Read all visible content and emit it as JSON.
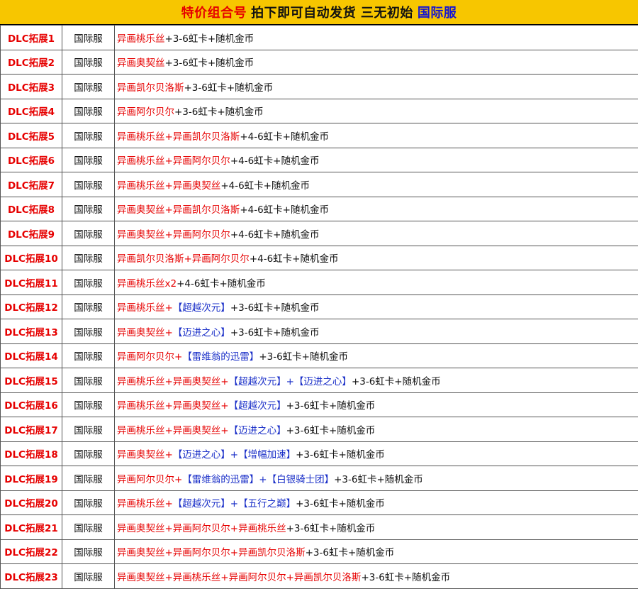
{
  "header": {
    "red": "特价组合号",
    "black": "拍下即可自动发货 三无初始",
    "blue": "国际服"
  },
  "colors": {
    "red": "#e60000",
    "blue": "#1a2fc8",
    "black": "#111111",
    "header_bg": "#f7c600"
  },
  "rows": [
    {
      "dlc": "DLC拓展1",
      "server": "国际服",
      "segs": [
        [
          "r",
          "异画桃乐丝"
        ],
        [
          "k",
          "+3-6虹卡+随机金币"
        ]
      ]
    },
    {
      "dlc": "DLC拓展2",
      "server": "国际服",
      "segs": [
        [
          "r",
          "异画奥契丝"
        ],
        [
          "k",
          "+3-6虹卡+随机金币"
        ]
      ]
    },
    {
      "dlc": "DLC拓展3",
      "server": "国际服",
      "segs": [
        [
          "r",
          "异画凯尔贝洛斯"
        ],
        [
          "k",
          "+3-6虹卡+随机金币"
        ]
      ]
    },
    {
      "dlc": "DLC拓展4",
      "server": "国际服",
      "segs": [
        [
          "r",
          "异画阿尔贝尔"
        ],
        [
          "k",
          "+3-6虹卡+随机金币"
        ]
      ]
    },
    {
      "dlc": "DLC拓展5",
      "server": "国际服",
      "segs": [
        [
          "r",
          "异画桃乐丝+异画凯尔贝洛斯"
        ],
        [
          "k",
          "+4-6虹卡+随机金币"
        ]
      ]
    },
    {
      "dlc": "DLC拓展6",
      "server": "国际服",
      "segs": [
        [
          "r",
          "异画桃乐丝+异画阿尔贝尔"
        ],
        [
          "k",
          "+4-6虹卡+随机金币"
        ]
      ]
    },
    {
      "dlc": "DLC拓展7",
      "server": "国际服",
      "segs": [
        [
          "r",
          "异画桃乐丝+异画奥契丝"
        ],
        [
          "k",
          "+4-6虹卡+随机金币"
        ]
      ]
    },
    {
      "dlc": "DLC拓展8",
      "server": "国际服",
      "segs": [
        [
          "r",
          "异画奥契丝+异画凯尔贝洛斯"
        ],
        [
          "k",
          "+4-6虹卡+随机金币"
        ]
      ]
    },
    {
      "dlc": "DLC拓展9",
      "server": "国际服",
      "segs": [
        [
          "r",
          "异画奥契丝+异画阿尔贝尔"
        ],
        [
          "k",
          "+4-6虹卡+随机金币"
        ]
      ]
    },
    {
      "dlc": "DLC拓展10",
      "server": "国际服",
      "segs": [
        [
          "r",
          "异画凯尔贝洛斯+异画阿尔贝尔"
        ],
        [
          "k",
          "+4-6虹卡+随机金币"
        ]
      ]
    },
    {
      "dlc": "DLC拓展11",
      "server": "国际服",
      "segs": [
        [
          "r",
          "异画桃乐丝x2"
        ],
        [
          "k",
          "+4-6虹卡+随机金币"
        ]
      ]
    },
    {
      "dlc": "DLC拓展12",
      "server": "国际服",
      "segs": [
        [
          "r",
          "异画桃乐丝+"
        ],
        [
          "b",
          "【超越次元】"
        ],
        [
          "k",
          "+3-6虹卡+随机金币"
        ]
      ]
    },
    {
      "dlc": "DLC拓展13",
      "server": "国际服",
      "segs": [
        [
          "r",
          "异画奥契丝+"
        ],
        [
          "b",
          "【迈进之心】"
        ],
        [
          "k",
          "+3-6虹卡+随机金币"
        ]
      ]
    },
    {
      "dlc": "DLC拓展14",
      "server": "国际服",
      "segs": [
        [
          "r",
          "异画阿尔贝尔+"
        ],
        [
          "b",
          "【雷维翁的迅雷】"
        ],
        [
          "k",
          "+3-6虹卡+随机金币"
        ]
      ]
    },
    {
      "dlc": "DLC拓展15",
      "server": "国际服",
      "segs": [
        [
          "r",
          "异画桃乐丝+异画奥契丝+"
        ],
        [
          "b",
          "【超越次元】+【迈进之心】"
        ],
        [
          "k",
          "+3-6虹卡+随机金币"
        ]
      ]
    },
    {
      "dlc": "DLC拓展16",
      "server": "国际服",
      "segs": [
        [
          "r",
          "异画桃乐丝+异画奥契丝+"
        ],
        [
          "b",
          "【超越次元】"
        ],
        [
          "k",
          "+3-6虹卡+随机金币"
        ]
      ]
    },
    {
      "dlc": "DLC拓展17",
      "server": "国际服",
      "segs": [
        [
          "r",
          "异画桃乐丝+异画奥契丝+"
        ],
        [
          "b",
          "【迈进之心】"
        ],
        [
          "k",
          "+3-6虹卡+随机金币"
        ]
      ]
    },
    {
      "dlc": "DLC拓展18",
      "server": "国际服",
      "segs": [
        [
          "r",
          "异画奥契丝+"
        ],
        [
          "b",
          "【迈进之心】+【增幅加速】"
        ],
        [
          "k",
          "+3-6虹卡+随机金币"
        ]
      ]
    },
    {
      "dlc": "DLC拓展19",
      "server": "国际服",
      "segs": [
        [
          "r",
          "异画阿尔贝尔+"
        ],
        [
          "b",
          "【雷维翁的迅雷】+【白银骑士团】"
        ],
        [
          "k",
          "+3-6虹卡+随机金币"
        ]
      ]
    },
    {
      "dlc": "DLC拓展20",
      "server": "国际服",
      "segs": [
        [
          "r",
          "异画桃乐丝+"
        ],
        [
          "b",
          "【超越次元】+【五行之巅】"
        ],
        [
          "k",
          "+3-6虹卡+随机金币"
        ]
      ]
    },
    {
      "dlc": "DLC拓展21",
      "server": "国际服",
      "segs": [
        [
          "r",
          "异画奥契丝+异画阿尔贝尔+异画桃乐丝"
        ],
        [
          "k",
          "+3-6虹卡+随机金币"
        ]
      ]
    },
    {
      "dlc": "DLC拓展22",
      "server": "国际服",
      "segs": [
        [
          "r",
          "异画奥契丝+异画阿尔贝尔+异画凯尔贝洛斯"
        ],
        [
          "k",
          "+3-6虹卡+随机金币"
        ]
      ]
    },
    {
      "dlc": "DLC拓展23",
      "server": "国际服",
      "segs": [
        [
          "r",
          "异画奥契丝+异画桃乐丝+异画阿尔贝尔+异画凯尔贝洛斯"
        ],
        [
          "k",
          "+3-6虹卡+随机金币"
        ]
      ]
    }
  ]
}
